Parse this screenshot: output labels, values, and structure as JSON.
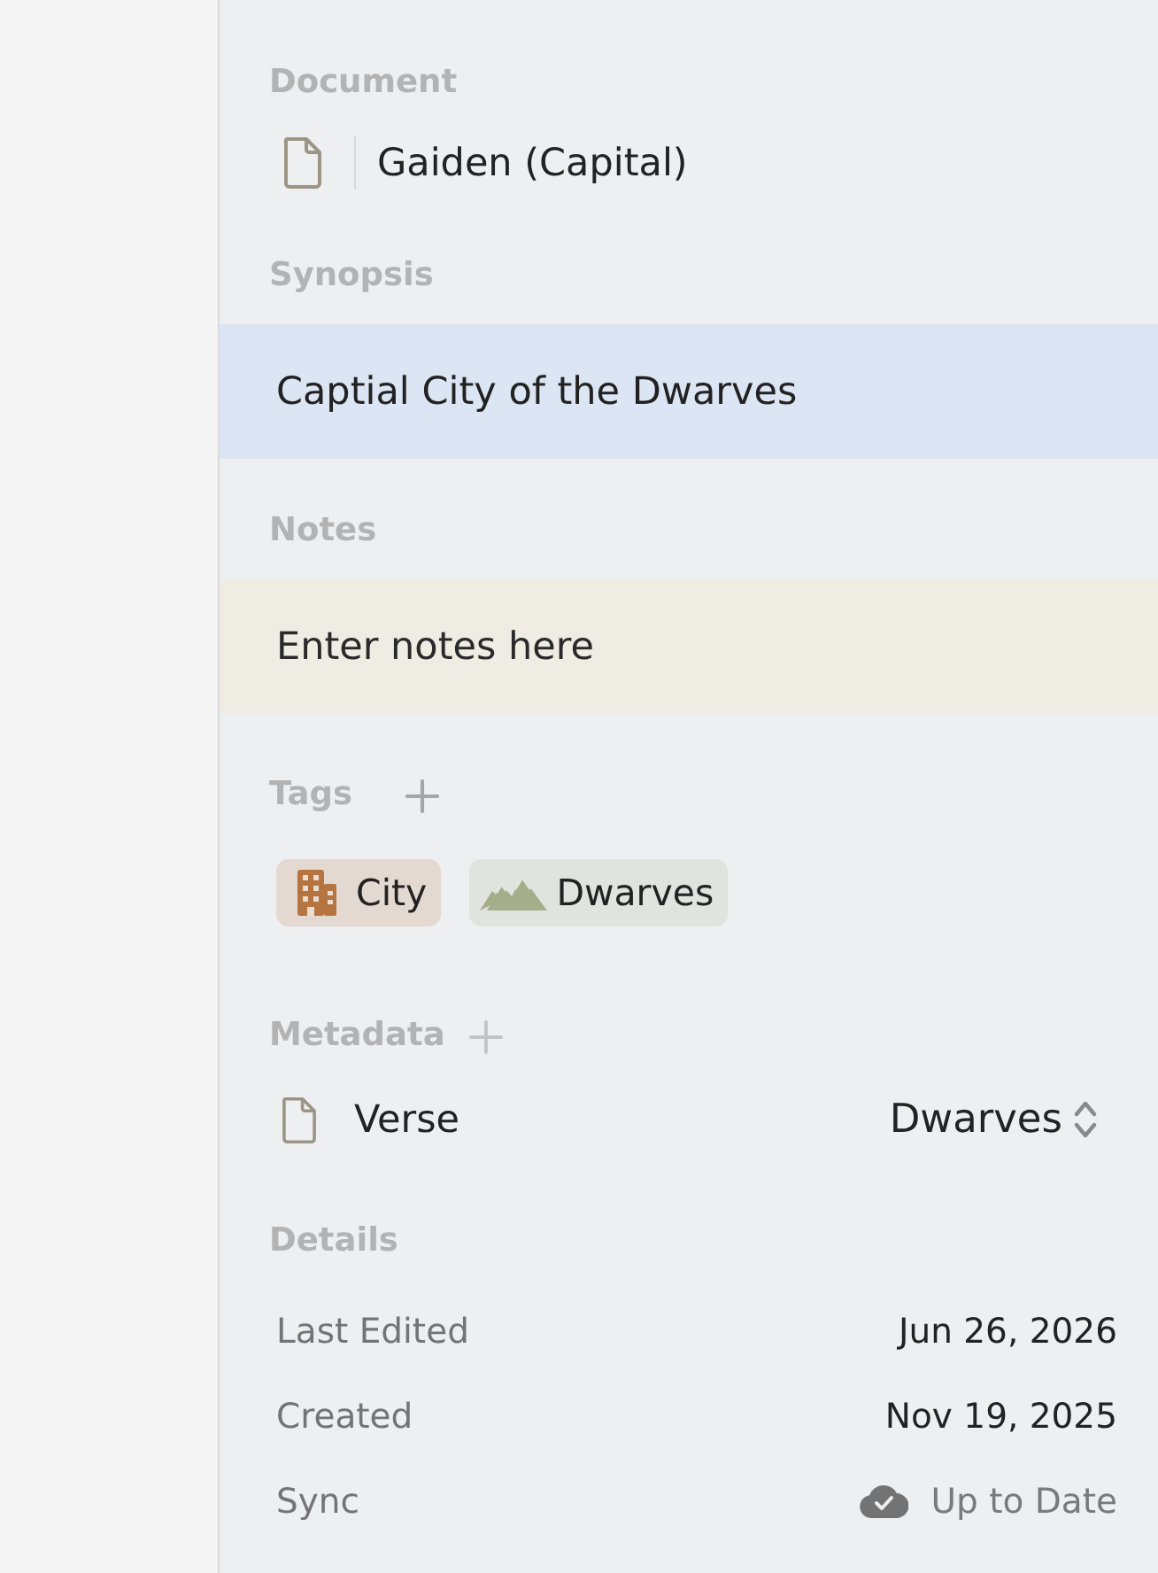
{
  "document": {
    "label": "Document",
    "name": "Gaiden (Capital)"
  },
  "synopsis": {
    "label": "Synopsis",
    "value": "Captial City of the Dwarves"
  },
  "notes": {
    "label": "Notes",
    "placeholder": "Enter notes here"
  },
  "tags": {
    "label": "Tags",
    "items": [
      {
        "kind": "building",
        "label": "City",
        "color": "#b57440"
      },
      {
        "kind": "mountains",
        "label": "Dwarves",
        "color": "#a4ae8a"
      }
    ]
  },
  "metadata": {
    "label": "Metadata",
    "fields": [
      {
        "name": "Verse",
        "value": "Dwarves"
      }
    ]
  },
  "details": {
    "label": "Details",
    "rows": [
      {
        "kind": "text",
        "label": "Last Edited",
        "value": "Jun 26, 2026"
      },
      {
        "kind": "text",
        "label": "Created",
        "value": "Nov 19, 2025"
      },
      {
        "kind": "sync",
        "label": "Sync",
        "value": "Up to Date"
      }
    ]
  }
}
